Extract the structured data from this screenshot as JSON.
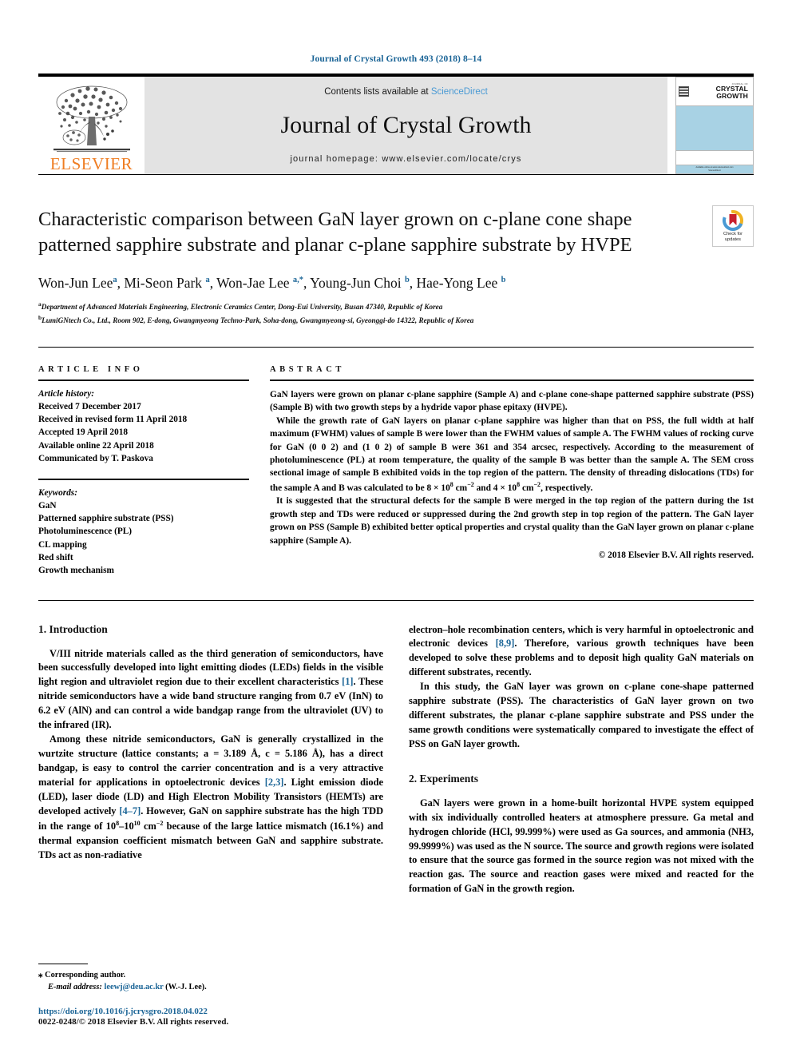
{
  "running_head": "Journal of Crystal Growth 493 (2018) 8–14",
  "masthead": {
    "publisher_logo_label": "ELSEVIER",
    "contents_prefix": "Contents lists available at ",
    "sciencedirect": "ScienceDirect",
    "journal_name": "Journal of Crystal Growth",
    "homepage_line": "journal homepage: www.elsevier.com/locate/crys",
    "cover": {
      "kicker": "JOURNAL OF",
      "title_line1": "CRYSTAL",
      "title_line2": "GROWTH",
      "footer_line1": "Available online at www.sciencedirect.com",
      "footer_line2": "ScienceDirect"
    }
  },
  "article": {
    "title": "Characteristic comparison between GaN layer grown on c-plane cone shape patterned sapphire substrate and planar c-plane sapphire substrate by HVPE",
    "crossmark": {
      "line1": "Check for",
      "line2": "updates"
    },
    "authors": [
      {
        "name": "Won-Jun Lee",
        "marks": "a",
        "sep": ", "
      },
      {
        "name": "Mi-Seon Park ",
        "marks": "a",
        "sep": ", "
      },
      {
        "name": "Won-Jae Lee ",
        "marks": "a,*",
        "sep": ", "
      },
      {
        "name": "Young-Jun Choi ",
        "marks": "b",
        "sep": ", "
      },
      {
        "name": "Hae-Yong Lee ",
        "marks": "b",
        "sep": ""
      }
    ],
    "affiliations": [
      {
        "mark": "a",
        "text": "Department of Advanced Materials Engineering, Electronic Ceramics Center, Dong-Eui University, Busan 47340, Republic of Korea"
      },
      {
        "mark": "b",
        "text": "LumiGNtech Co., Ltd., Room 902, E-dong, Gwangmyeong Techno-Park, Soha-dong, Gwangmyeong-si, Gyeonggi-do 14322, Republic of Korea"
      }
    ]
  },
  "article_info": {
    "heading": "ARTICLE INFO",
    "history_label": "Article history:",
    "history": [
      "Received 7 December 2017",
      "Received in revised form 11 April 2018",
      "Accepted 19 April 2018",
      "Available online 22 April 2018",
      "Communicated by T. Paskova"
    ],
    "keywords_label": "Keywords:",
    "keywords": [
      "GaN",
      "Patterned sapphire substrate (PSS)",
      "Photoluminescence (PL)",
      "CL mapping",
      "Red shift",
      "Growth mechanism"
    ]
  },
  "abstract": {
    "heading": "ABSTRACT",
    "p1": "GaN layers were grown on planar c-plane sapphire (Sample A) and c-plane cone-shape patterned sapphire substrate (PSS) (Sample B) with two growth steps by a hydride vapor phase epitaxy (HVPE).",
    "p2_a": "While the growth rate of GaN layers on planar c-plane sapphire was higher than that on PSS, the full width at half maximum (FWHM) values of sample B were lower than the FWHM values of sample A. The FWHM values of rocking curve for GaN (0 0 2) and (1 0 2) of sample B were 361 and 354 arcsec, respectively. According to the measurement of photoluminescence (PL) at room temperature, the quality of the sample B was better than the sample A. The SEM cross sectional image of sample B exhibited voids in the top region of the pattern. The density of threading dislocations (TDs) for the sample A and B was calculated to be 8 × 10",
    "p2_exp1": "8",
    "p2_b": " cm",
    "p2_exp2": "−2",
    "p2_c": " and 4 × 10",
    "p2_exp3": "8",
    "p2_d": " cm",
    "p2_exp4": "−2",
    "p2_e": ", respectively.",
    "p3": "It is suggested that the structural defects for the sample B were merged in the top region of the pattern during the 1st growth step and TDs were reduced or suppressed during the 2nd growth step in top region of the pattern. The GaN layer grown on PSS (Sample B) exhibited better optical properties and crystal quality than the GaN layer grown on planar c-plane sapphire (Sample A).",
    "copyright": "© 2018 Elsevier B.V. All rights reserved."
  },
  "body": {
    "left": {
      "section1_heading": "1. Introduction",
      "p1_a": "V/III nitride materials called as the third generation of semiconductors, have been successfully developed into light emitting diodes (LEDs) fields in the visible light region and ultraviolet region due to their excellent characteristics ",
      "p1_ref": "[1]",
      "p1_b": ". These nitride semiconductors have a wide band structure ranging from 0.7 eV (InN) to 6.2 eV (AlN) and can control a wide bandgap range from the ultraviolet (UV) to the infrared (IR).",
      "p2_a": "Among these nitride semiconductors, GaN is generally crystallized in the wurtzite structure (lattice constants; a = 3.189 Å, c = 5.186 Å), has a direct bandgap, is easy to control the carrier concentration and is a very attractive material for applications in optoelectronic devices ",
      "p2_ref1": "[2,3]",
      "p2_b": ". Light emission diode (LED), laser diode (LD) and High Electron Mobility Transistors (HEMTs) are developed actively ",
      "p2_ref2": "[4–7]",
      "p2_c": ". However, GaN on sapphire substrate has the high TDD in the range of 10",
      "p2_exp1": "8",
      "p2_d": "–10",
      "p2_exp2": "10",
      "p2_e": " cm",
      "p2_exp3": "−2",
      "p2_f": " because of the large lattice mismatch (16.1%) and thermal expansion coefficient mismatch between GaN and sapphire substrate. TDs act as non-radiative"
    },
    "right": {
      "p1_a": "electron–hole recombination centers, which is very harmful in optoelectronic and electronic devices ",
      "p1_ref": "[8,9]",
      "p1_b": ". Therefore, various growth techniques have been developed to solve these problems and to deposit high quality GaN materials on different substrates, recently.",
      "p2": "In this study, the GaN layer was grown on c-plane cone-shape patterned sapphire substrate (PSS). The characteristics of GaN layer grown on two different substrates, the planar c-plane sapphire substrate and PSS under the same growth conditions were systematically compared to investigate the effect of PSS on GaN layer growth.",
      "section2_heading": "2. Experiments",
      "p3": "GaN layers were grown in a home-built horizontal HVPE system equipped with six individually controlled heaters at atmosphere pressure. Ga metal and hydrogen chloride (HCl, 99.999%) were used as Ga sources, and ammonia (NH3, 99.9999%) was used as the N source. The source and growth regions were isolated to ensure that the source gas formed in the source region was not mixed with the reaction gas. The source and reaction gases were mixed and reacted for the formation of GaN in the growth region."
    }
  },
  "footnotes": {
    "corresponding_star": "⁎",
    "corresponding_text": " Corresponding author.",
    "email_label": "E-mail address:",
    "email": "leewj@deu.ac.kr",
    "email_suffix": " (W.-J. Lee).",
    "doi": "https://doi.org/10.1016/j.jcrysgro.2018.04.022",
    "issn": "0022-0248/© 2018 Elsevier B.V. All rights reserved."
  },
  "colors": {
    "link": "#1a6496",
    "sciencedirect": "#4a9ad4",
    "elsevier_orange": "#ef7d22",
    "masthead_grey": "#e3e3e3",
    "cover_blue": "#a8d2e4",
    "crossmark_red": "#c8202d",
    "crossmark_yellow": "#f0b323",
    "crossmark_blue": "#4a9ad4"
  }
}
